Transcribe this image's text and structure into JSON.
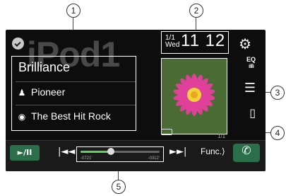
{
  "callouts": [
    "1",
    "2",
    "3",
    "4",
    "5"
  ],
  "screen": {
    "background_title": "iPod1",
    "source_icon": "checkmark-circle-icon",
    "track": {
      "title": "Brilliance",
      "artist": "Pioneer",
      "album": "The Best Hit Rock",
      "artist_icon": "person-icon",
      "album_icon": "disc-icon"
    },
    "clock": {
      "date": "1/1",
      "weekday": "Wed",
      "time": "11 12"
    },
    "settings_icon": "gear-icon",
    "eq_label": "EQ",
    "eq_bars": "ılıllı",
    "list_icon": "list-icon",
    "phone_icon": "phone-icon",
    "track_counter": "1/1",
    "controls": {
      "play_pause": "►/II",
      "prev": "|◄◄",
      "next": "►►|",
      "elapsed": "-0721'",
      "remaining": "-0312'",
      "progress": 0.38,
      "func_label": "Func.⟩",
      "call": "✆"
    },
    "colors": {
      "accent": "#2a6e4a",
      "progress": "#5fcf5f"
    }
  }
}
